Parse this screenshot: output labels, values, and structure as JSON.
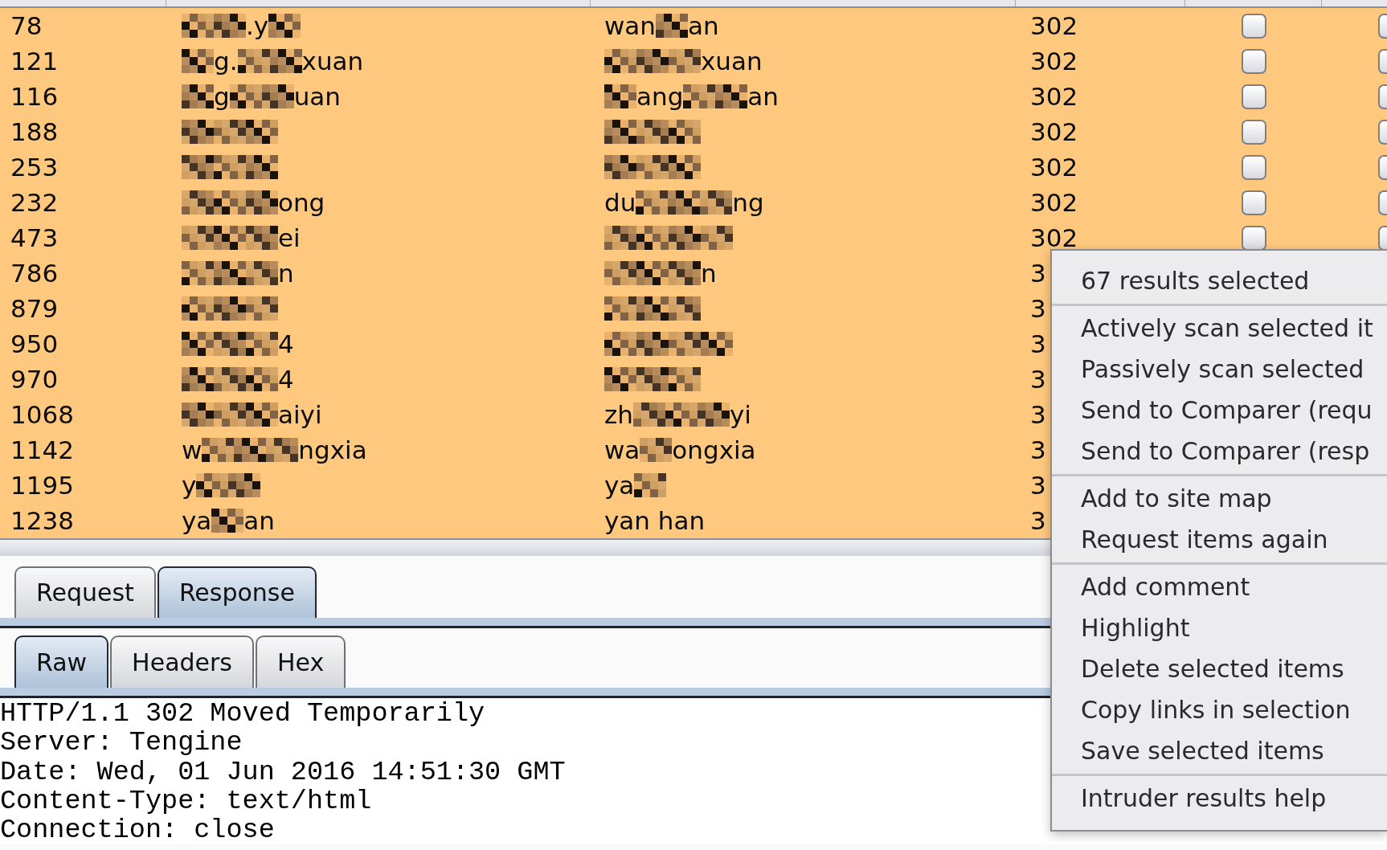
{
  "results_table": {
    "rows": [
      {
        "selected": true,
        "column_1": "78",
        "column_2": [
          {
            "kind": "mosaic"
          },
          {
            "kind": "mosaic"
          },
          {
            "kind": "text",
            "text": ".y"
          },
          {
            "kind": "mosaic"
          }
        ],
        "column_3": [
          {
            "kind": "text",
            "text": "wan"
          },
          {
            "kind": "mosaic"
          },
          {
            "kind": "text",
            "text": "an"
          }
        ],
        "column_4": "302",
        "column_5": {
          "checked": false
        },
        "column_6": {
          "checked": false
        }
      },
      {
        "selected": true,
        "column_1": "121",
        "column_2": [
          {
            "kind": "mosaic"
          },
          {
            "kind": "text",
            "text": "g."
          },
          {
            "kind": "mosaic"
          },
          {
            "kind": "mosaic"
          },
          {
            "kind": "text",
            "text": "xuan"
          }
        ],
        "column_3": [
          {
            "kind": "mosaic"
          },
          {
            "kind": "mosaic"
          },
          {
            "kind": "mosaic"
          },
          {
            "kind": "text",
            "text": "xuan"
          }
        ],
        "column_4": "302",
        "column_5": {
          "checked": false
        },
        "column_6": {
          "checked": false
        }
      },
      {
        "selected": true,
        "column_1": "116",
        "column_2": [
          {
            "kind": "mosaic"
          },
          {
            "kind": "text",
            "text": "g"
          },
          {
            "kind": "mosaic"
          },
          {
            "kind": "mosaic"
          },
          {
            "kind": "text",
            "text": "uan"
          }
        ],
        "column_3": [
          {
            "kind": "mosaic"
          },
          {
            "kind": "text",
            "text": "ang"
          },
          {
            "kind": "mosaic"
          },
          {
            "kind": "mosaic"
          },
          {
            "kind": "text",
            "text": "an"
          }
        ],
        "column_4": "302",
        "column_5": {
          "checked": false
        },
        "column_6": {
          "checked": false
        }
      },
      {
        "selected": true,
        "column_1": "188",
        "column_2": [
          {
            "kind": "mosaic"
          },
          {
            "kind": "mosaic"
          },
          {
            "kind": "mosaic"
          }
        ],
        "column_3": [
          {
            "kind": "mosaic"
          },
          {
            "kind": "mosaic"
          },
          {
            "kind": "mosaic"
          }
        ],
        "column_4": "302",
        "column_5": {
          "checked": false
        },
        "column_6": {
          "checked": false
        }
      },
      {
        "selected": true,
        "column_1": "253",
        "column_2": [
          {
            "kind": "mosaic"
          },
          {
            "kind": "mosaic"
          },
          {
            "kind": "mosaic"
          }
        ],
        "column_3": [
          {
            "kind": "mosaic"
          },
          {
            "kind": "mosaic"
          },
          {
            "kind": "mosaic"
          }
        ],
        "column_4": "302",
        "column_5": {
          "checked": false
        },
        "column_6": {
          "checked": false
        }
      },
      {
        "selected": true,
        "column_1": "232",
        "column_2": [
          {
            "kind": "mosaic"
          },
          {
            "kind": "mosaic"
          },
          {
            "kind": "mosaic"
          },
          {
            "kind": "text",
            "text": "ong"
          }
        ],
        "column_3": [
          {
            "kind": "text",
            "text": "du"
          },
          {
            "kind": "mosaic"
          },
          {
            "kind": "mosaic"
          },
          {
            "kind": "mosaic"
          },
          {
            "kind": "text",
            "text": "ng"
          }
        ],
        "column_4": "302",
        "column_5": {
          "checked": false
        },
        "column_6": {
          "checked": false
        }
      },
      {
        "selected": true,
        "column_1": "473",
        "column_2": [
          {
            "kind": "mosaic"
          },
          {
            "kind": "mosaic"
          },
          {
            "kind": "mosaic"
          },
          {
            "kind": "text",
            "text": "ei"
          }
        ],
        "column_3": [
          {
            "kind": "mosaic"
          },
          {
            "kind": "mosaic"
          },
          {
            "kind": "mosaic"
          },
          {
            "kind": "mosaic"
          }
        ],
        "column_4": "302",
        "column_5": {
          "checked": false
        },
        "column_6": {
          "checked": false
        }
      },
      {
        "selected": true,
        "column_1": "786",
        "column_2": [
          {
            "kind": "mosaic"
          },
          {
            "kind": "mosaic"
          },
          {
            "kind": "mosaic"
          },
          {
            "kind": "text",
            "text": "n"
          }
        ],
        "column_3": [
          {
            "kind": "mosaic"
          },
          {
            "kind": "mosaic"
          },
          {
            "kind": "mosaic"
          },
          {
            "kind": "text",
            "text": "n"
          }
        ],
        "column_4": "3"
      },
      {
        "selected": true,
        "column_1": "879",
        "column_2": [
          {
            "kind": "mosaic"
          },
          {
            "kind": "mosaic"
          },
          {
            "kind": "mosaic"
          }
        ],
        "column_3": [
          {
            "kind": "mosaic"
          },
          {
            "kind": "mosaic"
          },
          {
            "kind": "mosaic"
          }
        ],
        "column_4": "3"
      },
      {
        "selected": true,
        "column_1": "950",
        "column_2": [
          {
            "kind": "mosaic"
          },
          {
            "kind": "mosaic"
          },
          {
            "kind": "mosaic"
          },
          {
            "kind": "text",
            "text": "4"
          }
        ],
        "column_3": [
          {
            "kind": "mosaic"
          },
          {
            "kind": "mosaic"
          },
          {
            "kind": "mosaic"
          },
          {
            "kind": "mosaic"
          }
        ],
        "column_4": "3"
      },
      {
        "selected": true,
        "column_1": "970",
        "column_2": [
          {
            "kind": "mosaic"
          },
          {
            "kind": "mosaic"
          },
          {
            "kind": "mosaic"
          },
          {
            "kind": "text",
            "text": "4"
          }
        ],
        "column_3": [
          {
            "kind": "mosaic"
          },
          {
            "kind": "mosaic"
          },
          {
            "kind": "mosaic"
          }
        ],
        "column_4": "3"
      },
      {
        "selected": true,
        "column_1": "1068",
        "column_2": [
          {
            "kind": "mosaic"
          },
          {
            "kind": "mosaic"
          },
          {
            "kind": "mosaic"
          },
          {
            "kind": "text",
            "text": "aiyi"
          }
        ],
        "column_3": [
          {
            "kind": "text",
            "text": "zh"
          },
          {
            "kind": "mosaic"
          },
          {
            "kind": "mosaic"
          },
          {
            "kind": "mosaic"
          },
          {
            "kind": "text",
            "text": "yi"
          }
        ],
        "column_4": "3"
      },
      {
        "selected": true,
        "column_1": "1142",
        "column_2": [
          {
            "kind": "text",
            "text": "w"
          },
          {
            "kind": "mosaic"
          },
          {
            "kind": "mosaic"
          },
          {
            "kind": "mosaic"
          },
          {
            "kind": "text",
            "text": "ngxia"
          }
        ],
        "column_3": [
          {
            "kind": "text",
            "text": "wa"
          },
          {
            "kind": "mosaic"
          },
          {
            "kind": "text",
            "text": "ongxia"
          }
        ],
        "column_4": "3"
      },
      {
        "selected": true,
        "column_1": "1195",
        "column_2": [
          {
            "kind": "text",
            "text": "y"
          },
          {
            "kind": "mosaic"
          },
          {
            "kind": "mosaic"
          }
        ],
        "column_3": [
          {
            "kind": "text",
            "text": "ya"
          },
          {
            "kind": "mosaic"
          }
        ],
        "column_4": "3"
      },
      {
        "selected": true,
        "column_1": "1238",
        "column_2": [
          {
            "kind": "text",
            "text": "ya"
          },
          {
            "kind": "mosaic"
          },
          {
            "kind": "text",
            "text": "an"
          }
        ],
        "column_3": [
          {
            "kind": "text",
            "text": "yan han"
          }
        ],
        "column_4": "3"
      }
    ]
  },
  "message_tabs": [
    {
      "label": "Request",
      "selected": false
    },
    {
      "label": "Response",
      "selected": true
    }
  ],
  "view_tabs": [
    {
      "label": "Raw",
      "selected": true
    },
    {
      "label": "Headers",
      "selected": false
    },
    {
      "label": "Hex",
      "selected": false
    }
  ],
  "response_lines": [
    "HTTP/1.1 302 Moved Temporarily",
    "Server: Tengine",
    "Date: Wed, 01 Jun 2016 14:51:30 GMT",
    "Content-Type: text/html",
    "Connection: close"
  ],
  "context_menu": {
    "header": "67 results selected",
    "sections": [
      [
        "Actively scan selected it",
        "Passively scan selected",
        "Send to Comparer (requ",
        "Send to Comparer (resp"
      ],
      [
        "Add to site map",
        "Request items again"
      ],
      [
        "Add comment",
        "Highlight",
        "Delete selected items",
        "Copy links in selection",
        "Save selected items"
      ],
      [
        "Intruder results help"
      ]
    ]
  }
}
